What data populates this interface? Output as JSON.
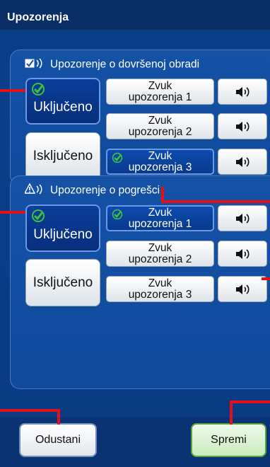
{
  "window": {
    "title": "Upozorenja"
  },
  "completed_section": {
    "title": "Upozorenje o dovršenoj obradi",
    "on_label": "Uključeno",
    "off_label": "Isključeno",
    "sounds": [
      {
        "line1": "Zvuk",
        "line2": "upozorenja 1",
        "selected": false
      },
      {
        "line1": "Zvuk",
        "line2": "upozorenja 2",
        "selected": false
      },
      {
        "line1": "Zvuk",
        "line2": "upozorenja 3",
        "selected": true
      }
    ]
  },
  "error_section": {
    "title": "Upozorenje o pogrešci",
    "on_label": "Uključeno",
    "off_label": "Isključeno",
    "sounds": [
      {
        "line1": "Zvuk",
        "line2": "upozorenja 1",
        "selected": true
      },
      {
        "line1": "Zvuk",
        "line2": "upozorenja 2",
        "selected": false
      },
      {
        "line1": "Zvuk",
        "line2": "upozorenja 3",
        "selected": false
      }
    ]
  },
  "footer": {
    "cancel_label": "Odustani",
    "save_label": "Spremi"
  },
  "colors": {
    "callout": "#e3101b",
    "check": "#3cc23b",
    "background": "#0a3f89"
  }
}
